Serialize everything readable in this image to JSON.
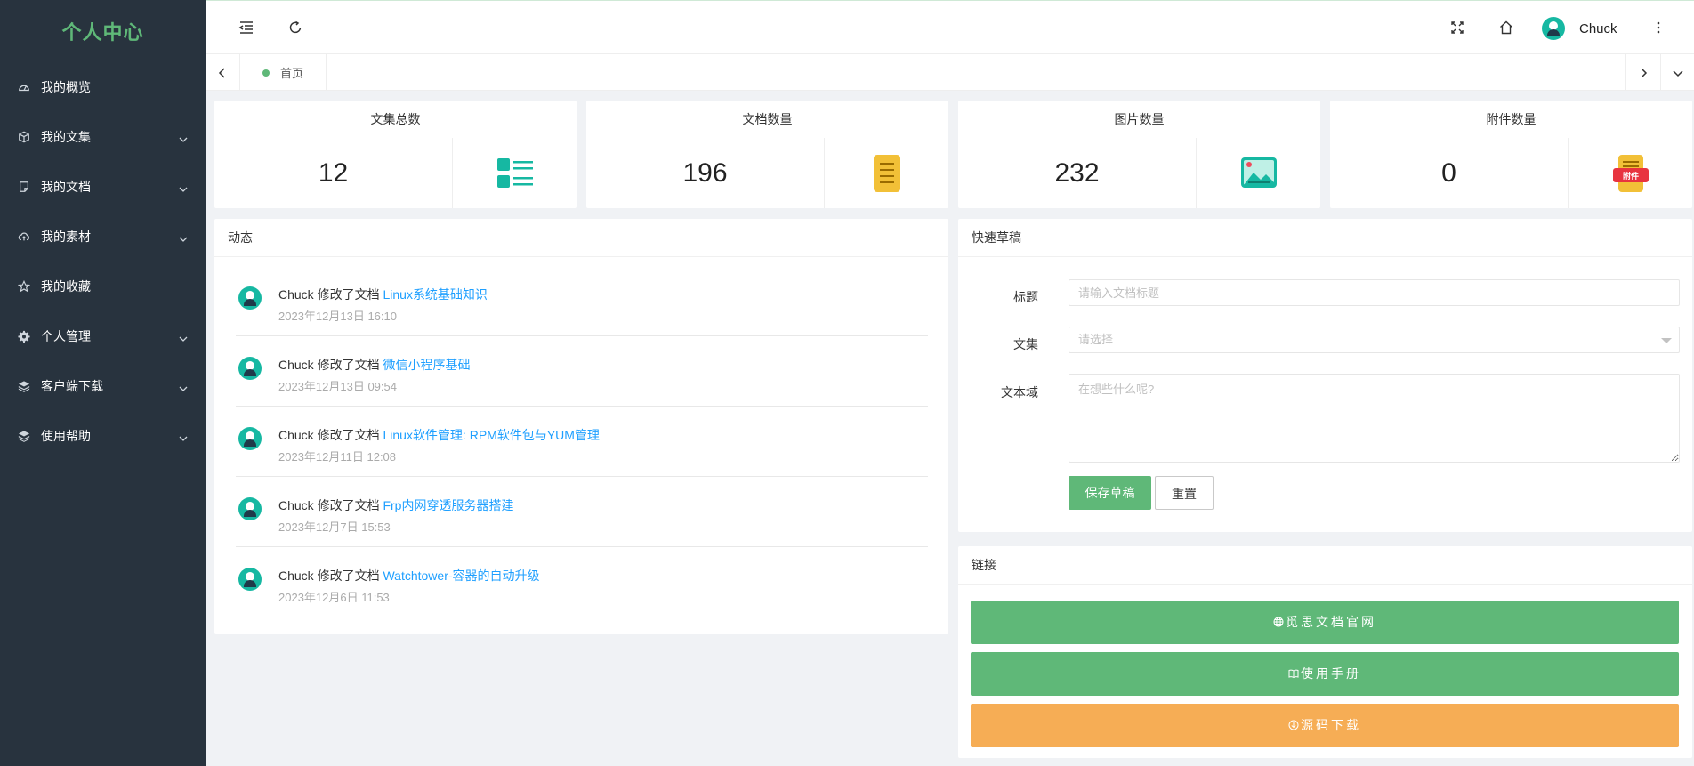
{
  "app": {
    "title": "个人中心"
  },
  "sidebar": {
    "items": [
      {
        "label": "我的概览",
        "icon": "dashboard-icon",
        "has_children": false
      },
      {
        "label": "我的文集",
        "icon": "cube-icon",
        "has_children": true
      },
      {
        "label": "我的文档",
        "icon": "note-icon",
        "has_children": true
      },
      {
        "label": "我的素材",
        "icon": "cloud-upload-icon",
        "has_children": true
      },
      {
        "label": "我的收藏",
        "icon": "star-icon",
        "has_children": false
      },
      {
        "label": "个人管理",
        "icon": "gear-icon",
        "has_children": true
      },
      {
        "label": "客户端下载",
        "icon": "layers-icon",
        "has_children": true
      },
      {
        "label": "使用帮助",
        "icon": "layers-icon",
        "has_children": true
      }
    ]
  },
  "header": {
    "user_name": "Chuck",
    "icons": [
      "menu-fold-icon",
      "refresh-icon",
      "fullscreen-icon",
      "home-icon",
      "more-vertical-icon"
    ]
  },
  "tabs": {
    "items": [
      {
        "label": "首页",
        "active": true
      }
    ]
  },
  "stats": [
    {
      "title": "文集总数",
      "value": "12",
      "icon": "list-icon",
      "color": "#16b8a2"
    },
    {
      "title": "文档数量",
      "value": "196",
      "icon": "document-icon",
      "color": "#f2c037"
    },
    {
      "title": "图片数量",
      "value": "232",
      "icon": "image-icon",
      "color": "#16b8a2"
    },
    {
      "title": "附件数量",
      "value": "0",
      "icon": "attachment-icon",
      "color": "#f2c037",
      "badge": "附件"
    }
  ],
  "activity": {
    "title": "动态",
    "items": [
      {
        "actor": "Chuck 修改了文档 ",
        "doc": "Linux系统基础知识",
        "time": "2023年12月13日 16:10"
      },
      {
        "actor": "Chuck 修改了文档 ",
        "doc": "微信小程序基础",
        "time": "2023年12月13日 09:54"
      },
      {
        "actor": "Chuck 修改了文档 ",
        "doc": "Linux软件管理: RPM软件包与YUM管理",
        "time": "2023年12月11日 12:08"
      },
      {
        "actor": "Chuck 修改了文档 ",
        "doc": "Frp内网穿透服务器搭建",
        "time": "2023年12月7日 15:53"
      },
      {
        "actor": "Chuck 修改了文档 ",
        "doc": "Watchtower-容器的自动升级",
        "time": "2023年12月6日 11:53"
      }
    ]
  },
  "draft": {
    "title": "快速草稿",
    "title_label": "标题",
    "title_placeholder": "请输入文档标题",
    "collection_label": "文集",
    "collection_placeholder": "请选择",
    "textarea_label": "文本域",
    "textarea_placeholder": "在想些什么呢?",
    "save_label": "保存草稿",
    "reset_label": "重置"
  },
  "links": {
    "title": "链接",
    "items": [
      {
        "label": "觅思文档官网",
        "icon": "globe-icon",
        "color": "#5fb878"
      },
      {
        "label": "使用手册",
        "icon": "book-icon",
        "color": "#5fb878"
      },
      {
        "label": "源码下载",
        "icon": "download-icon",
        "color": "#f6ad55"
      }
    ]
  }
}
